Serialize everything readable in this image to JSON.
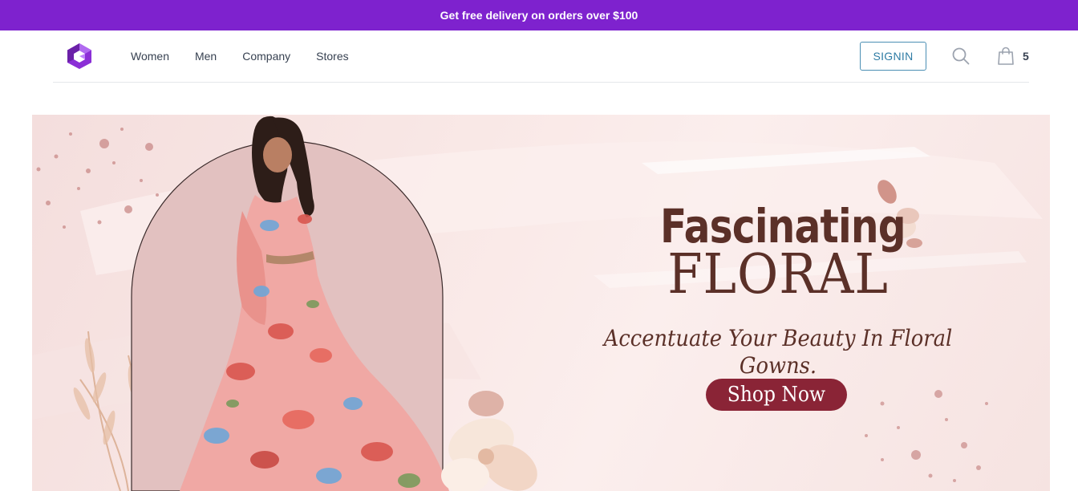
{
  "announcement": {
    "text": "Get free delivery on orders over $100"
  },
  "header": {
    "logo_icon": "brand-logo-icon",
    "nav": [
      {
        "label": "Women"
      },
      {
        "label": "Men"
      },
      {
        "label": "Company"
      },
      {
        "label": "Stores"
      }
    ],
    "signin_label": "SIGNIN",
    "search_icon": "search-icon",
    "cart_icon": "shopping-bag-icon",
    "cart_count": "5"
  },
  "hero": {
    "title_line1": "Fascinating",
    "title_line2": "FLORAL",
    "tagline": "Accentuate Your Beauty In Floral Gowns.",
    "cta_label": "Shop Now"
  },
  "colors": {
    "announcement_bg": "#7e22ce",
    "signin_border": "#4b8fb4",
    "hero_text": "#5b3028",
    "cta_bg": "#8a2436",
    "hero_bg": "#f9e8e6"
  }
}
